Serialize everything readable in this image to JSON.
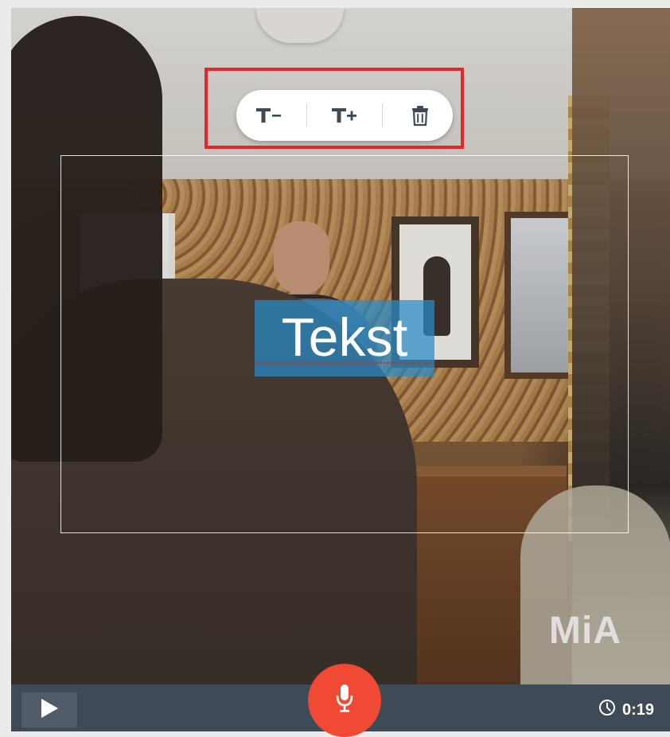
{
  "toolbar": {
    "decrease_icon": "text-size-decrease-icon",
    "increase_icon": "text-size-increase-icon",
    "delete_icon": "trash-icon",
    "highlight_color": "#e1262d"
  },
  "caption": {
    "text": "Tekst",
    "background_color": "#288cc8"
  },
  "watermark": {
    "text": "MiA"
  },
  "player": {
    "play_icon": "play-icon",
    "record_icon": "microphone-icon",
    "clock_icon": "clock-icon",
    "time": "0:19",
    "record_color": "#f04a34",
    "bar_color": "#3e4a56"
  }
}
